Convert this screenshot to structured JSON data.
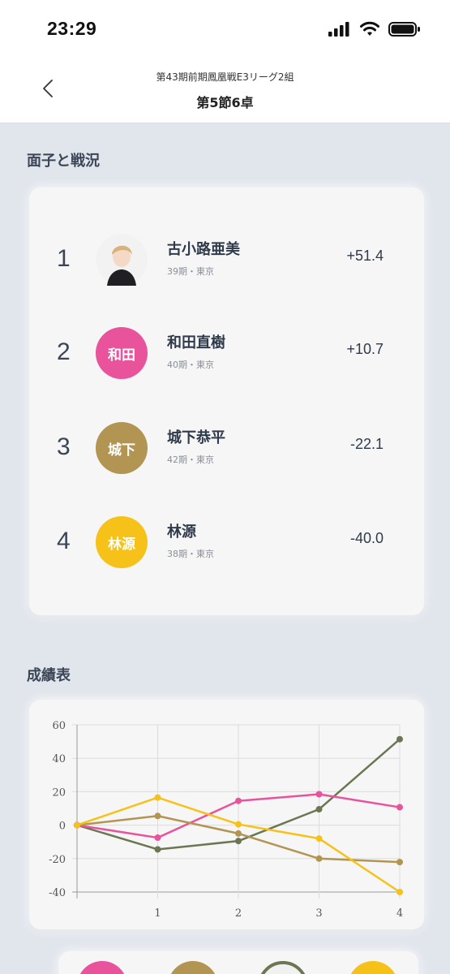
{
  "status_bar": {
    "time": "23:29"
  },
  "nav": {
    "subtitle": "第43期前期鳳凰戦E3リーグ2組",
    "title": "第5節6卓"
  },
  "standings": {
    "section_title": "面子と戦況",
    "players": [
      {
        "rank": "1",
        "name": "古小路亜美",
        "meta": "39期・東京",
        "score": "+51.4",
        "avatar_text": "",
        "avatar_type": "photo",
        "color": "#6b7652"
      },
      {
        "rank": "2",
        "name": "和田直樹",
        "meta": "40期・東京",
        "score": "+10.7",
        "avatar_text": "和田",
        "avatar_type": "initials",
        "color": "#e8539b"
      },
      {
        "rank": "3",
        "name": "城下恭平",
        "meta": "42期・東京",
        "score": "-22.1",
        "avatar_text": "城下",
        "avatar_type": "initials",
        "color": "#b39553"
      },
      {
        "rank": "4",
        "name": "林源",
        "meta": "38期・東京",
        "score": "-40.0",
        "avatar_text": "林源",
        "avatar_type": "initials",
        "color": "#f6c21a"
      }
    ]
  },
  "results": {
    "section_title": "成績表"
  },
  "chart_data": {
    "type": "line",
    "x": [
      0,
      1,
      2,
      3,
      4
    ],
    "xticks": [
      "1",
      "2",
      "3",
      "4"
    ],
    "yticks": [
      "60",
      "40",
      "20",
      "0",
      "-20",
      "-40"
    ],
    "ylim": [
      -40,
      60
    ],
    "xlim": [
      0,
      4
    ],
    "grid": true,
    "series": [
      {
        "color": "#6b7652",
        "values": [
          0,
          -14.5,
          -9.5,
          9.5,
          51.4
        ]
      },
      {
        "color": "#e8539b",
        "values": [
          0,
          -7.5,
          14.5,
          18.5,
          10.7
        ]
      },
      {
        "color": "#b39553",
        "values": [
          0,
          5.5,
          -5,
          -20,
          -22.1
        ]
      },
      {
        "color": "#f6c21a",
        "values": [
          0,
          16.5,
          0.5,
          -8,
          -40
        ]
      }
    ]
  },
  "legend": {
    "colors": [
      "#e8539b",
      "#b39553",
      "#6b7652",
      "#f6c21a"
    ]
  }
}
